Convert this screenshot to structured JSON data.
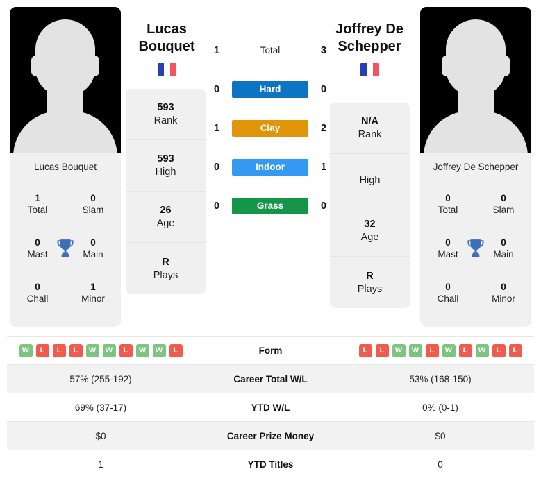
{
  "players": {
    "left": {
      "name": "Lucas Bouquet",
      "display_name_line1": "Lucas",
      "display_name_line2": "Bouquet",
      "flag": "france-flag",
      "titles": [
        {
          "value": "1",
          "label": "Total"
        },
        {
          "value": "0",
          "label": "Slam"
        },
        {
          "value": "0",
          "label": "Mast"
        },
        {
          "value": "0",
          "label": "Main"
        },
        {
          "value": "0",
          "label": "Chall"
        },
        {
          "value": "1",
          "label": "Minor"
        }
      ],
      "stats": [
        {
          "value": "593",
          "label": "Rank"
        },
        {
          "value": "593",
          "label": "High"
        },
        {
          "value": "26",
          "label": "Age"
        },
        {
          "value": "R",
          "label": "Plays"
        }
      ],
      "form": [
        "W",
        "L",
        "L",
        "L",
        "W",
        "W",
        "L",
        "W",
        "W",
        "L"
      ],
      "career_total_wl": "57% (255-192)",
      "ytd_wl": "69% (37-17)",
      "career_prize_money": "$0",
      "ytd_titles": "1"
    },
    "right": {
      "name": "Joffrey De Schepper",
      "display_name_line1": "Joffrey De",
      "display_name_line2": "Schepper",
      "flag": "france-flag",
      "titles": [
        {
          "value": "0",
          "label": "Total"
        },
        {
          "value": "0",
          "label": "Slam"
        },
        {
          "value": "0",
          "label": "Mast"
        },
        {
          "value": "0",
          "label": "Main"
        },
        {
          "value": "0",
          "label": "Chall"
        },
        {
          "value": "0",
          "label": "Minor"
        }
      ],
      "stats": [
        {
          "value": "N/A",
          "label": "Rank"
        },
        {
          "value": "",
          "label": "High"
        },
        {
          "value": "32",
          "label": "Age"
        },
        {
          "value": "R",
          "label": "Plays"
        }
      ],
      "form": [
        "L",
        "L",
        "W",
        "W",
        "L",
        "W",
        "L",
        "W",
        "L",
        "L"
      ],
      "career_total_wl": "53% (168-150)",
      "ytd_wl": "0% (0-1)",
      "career_prize_money": "$0",
      "ytd_titles": "0"
    }
  },
  "head_to_head": [
    {
      "label": "Total",
      "left": "1",
      "right": "3",
      "color": "",
      "style": "plain"
    },
    {
      "label": "Hard",
      "left": "0",
      "right": "0",
      "color": "#0d74c4",
      "style": "badge"
    },
    {
      "label": "Clay",
      "left": "1",
      "right": "2",
      "color": "#e09408",
      "style": "badge"
    },
    {
      "label": "Indoor",
      "left": "0",
      "right": "1",
      "color": "#3399f3",
      "style": "badge"
    },
    {
      "label": "Grass",
      "left": "0",
      "right": "0",
      "color": "#159547",
      "style": "badge"
    }
  ],
  "table_rows": [
    {
      "label": "Form",
      "type": "form"
    },
    {
      "label": "Career Total W/L",
      "type": "text",
      "left": "57% (255-192)",
      "right": "53% (168-150)"
    },
    {
      "label": "YTD W/L",
      "type": "text",
      "left": "69% (37-17)",
      "right": "0% (0-1)"
    },
    {
      "label": "Career Prize Money",
      "type": "text",
      "left": "$0",
      "right": "$0"
    },
    {
      "label": "YTD Titles",
      "type": "text",
      "left": "1",
      "right": "0"
    }
  ],
  "colors": {
    "win_badge": "#7cc47f",
    "loss_badge": "#f05b4f",
    "trophy": "#3b6fb6",
    "panel_bg": "#f0f0f0",
    "row_alt_bg": "#f2f2f2"
  },
  "icons": {
    "trophy": "trophy-icon",
    "flag": "france-flag-icon"
  }
}
